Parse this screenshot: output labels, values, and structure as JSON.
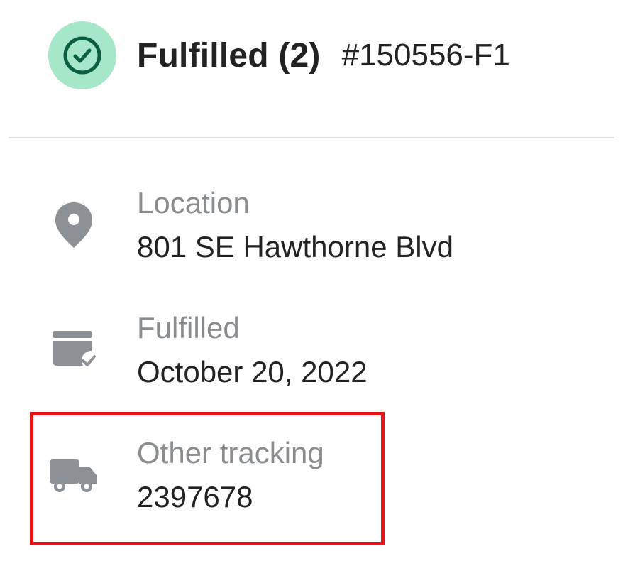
{
  "header": {
    "status_icon": "check-circle-icon",
    "title": "Fulfilled (2)",
    "order_id": "#150556-F1",
    "status_color": "#a6e6c9",
    "check_color": "#0b5e3f"
  },
  "details": {
    "location": {
      "icon": "location-pin-icon",
      "label": "Location",
      "value": "801 SE Hawthorne Blvd"
    },
    "fulfilled": {
      "icon": "package-check-icon",
      "label": "Fulfilled",
      "value": "October 20, 2022"
    },
    "tracking": {
      "icon": "truck-icon",
      "label": "Other tracking",
      "value": "2397678"
    }
  },
  "highlight_color": "#e8141b"
}
